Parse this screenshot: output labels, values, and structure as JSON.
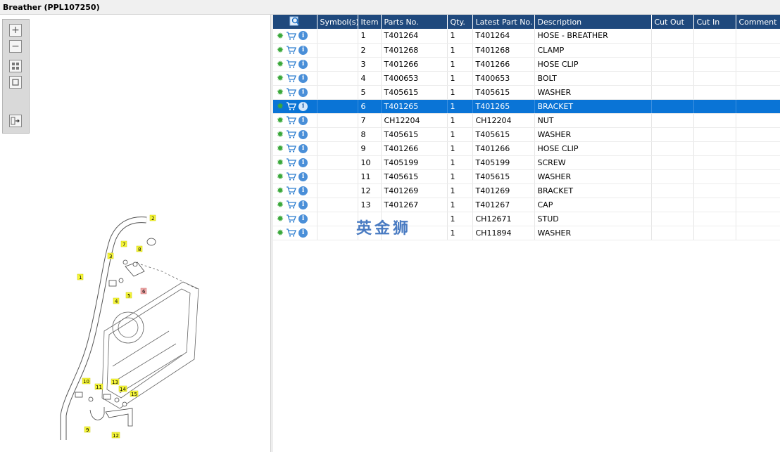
{
  "window": {
    "title": "Breather (PPL107250)"
  },
  "toolbar": {
    "zoom_in": "+",
    "zoom_out": "−"
  },
  "grid": {
    "columns": [
      "",
      "Symbol(s)",
      "Item",
      "Parts No.",
      "Qty.",
      "Latest Part No.",
      "Description",
      "Cut Out",
      "Cut In",
      "Comment"
    ],
    "selected_index": 5,
    "rows": [
      {
        "item": "1",
        "part": "T401264",
        "qty": "1",
        "latest": "T401264",
        "desc": "HOSE - BREATHER"
      },
      {
        "item": "2",
        "part": "T401268",
        "qty": "1",
        "latest": "T401268",
        "desc": "CLAMP"
      },
      {
        "item": "3",
        "part": "T401266",
        "qty": "1",
        "latest": "T401266",
        "desc": "HOSE CLIP"
      },
      {
        "item": "4",
        "part": "T400653",
        "qty": "1",
        "latest": "T400653",
        "desc": "BOLT"
      },
      {
        "item": "5",
        "part": "T405615",
        "qty": "1",
        "latest": "T405615",
        "desc": "WASHER"
      },
      {
        "item": "6",
        "part": "T401265",
        "qty": "1",
        "latest": "T401265",
        "desc": "BRACKET"
      },
      {
        "item": "7",
        "part": "CH12204",
        "qty": "1",
        "latest": "CH12204",
        "desc": "NUT"
      },
      {
        "item": "8",
        "part": "T405615",
        "qty": "1",
        "latest": "T405615",
        "desc": "WASHER"
      },
      {
        "item": "9",
        "part": "T401266",
        "qty": "1",
        "latest": "T401266",
        "desc": "HOSE CLIP"
      },
      {
        "item": "10",
        "part": "T405199",
        "qty": "1",
        "latest": "T405199",
        "desc": "SCREW"
      },
      {
        "item": "11",
        "part": "T405615",
        "qty": "1",
        "latest": "T405615",
        "desc": "WASHER"
      },
      {
        "item": "12",
        "part": "T401269",
        "qty": "1",
        "latest": "T401269",
        "desc": "BRACKET"
      },
      {
        "item": "13",
        "part": "T401267",
        "qty": "1",
        "latest": "T401267",
        "desc": "CAP"
      },
      {
        "item": "",
        "part": "",
        "qty": "1",
        "latest": "CH12671",
        "desc": "STUD"
      },
      {
        "item": "",
        "part": "",
        "qty": "1",
        "latest": "CH11894",
        "desc": "WASHER"
      }
    ]
  },
  "watermark": "英金狮",
  "diagram": {
    "callouts": [
      "1",
      "2",
      "3",
      "4",
      "5",
      "6",
      "7",
      "8",
      "9",
      "10",
      "11",
      "12",
      "13",
      "14",
      "15"
    ]
  },
  "colors": {
    "header": "#1f497d",
    "selected_row": "#0a74d6",
    "callout_yellow": "#f7f73a",
    "callout_red": "#f1a9a9"
  }
}
